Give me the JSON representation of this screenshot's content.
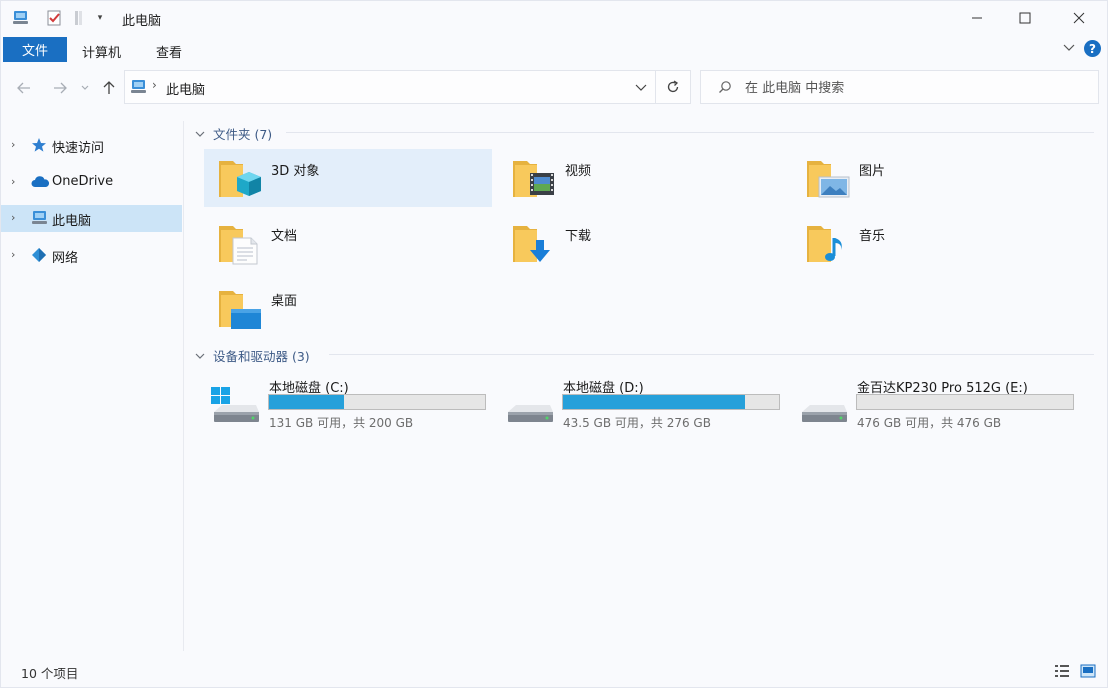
{
  "window": {
    "title": "此电脑",
    "quick_access_toolbar": [
      "computer-icon",
      "properties-check-icon",
      "new-folder-icon",
      "customize-dropdown-icon"
    ],
    "controls": [
      "minimize",
      "maximize",
      "close"
    ]
  },
  "ribbon": {
    "tabs": [
      {
        "label": "文件",
        "active": true
      },
      {
        "label": "计算机"
      },
      {
        "label": "查看"
      }
    ],
    "help_label": "?"
  },
  "address_bar": {
    "path": [
      "此电脑"
    ],
    "search_placeholder": "在 此电脑 中搜索"
  },
  "sidebar": {
    "items": [
      {
        "label": "快速访问",
        "icon": "star-icon"
      },
      {
        "label": "OneDrive",
        "icon": "cloud-icon"
      },
      {
        "label": "此电脑",
        "icon": "computer-icon",
        "selected": true
      },
      {
        "label": "网络",
        "icon": "network-icon"
      }
    ]
  },
  "folders_group": {
    "header": "文件夹 (7)",
    "items": [
      {
        "label": "3D 对象",
        "icon": "3d-objects-folder-icon",
        "selected": true
      },
      {
        "label": "视频",
        "icon": "videos-folder-icon"
      },
      {
        "label": "图片",
        "icon": "pictures-folder-icon"
      },
      {
        "label": "文档",
        "icon": "documents-folder-icon"
      },
      {
        "label": "下载",
        "icon": "downloads-folder-icon"
      },
      {
        "label": "音乐",
        "icon": "music-folder-icon"
      },
      {
        "label": "桌面",
        "icon": "desktop-folder-icon"
      }
    ]
  },
  "drives_group": {
    "header": "设备和驱动器 (3)",
    "items": [
      {
        "label": "本地磁盘 (C:)",
        "free_text": "131 GB 可用，共 200 GB",
        "used_fraction": 0.345,
        "icon": "windows-drive-icon"
      },
      {
        "label": "本地磁盘 (D:)",
        "free_text": "43.5 GB 可用，共 276 GB",
        "used_fraction": 0.842,
        "icon": "drive-icon"
      },
      {
        "label": "金百达KP230 Pro 512G (E:)",
        "free_text": "476 GB 可用，共 476 GB",
        "used_fraction": 0.0,
        "icon": "drive-icon"
      }
    ]
  },
  "status_bar": {
    "item_count": "10 个项目"
  },
  "colors": {
    "accent": "#1a6fc2",
    "selection": "#cce4f7",
    "drive_fill": "#26a0da",
    "folder": "#f8c95c"
  }
}
